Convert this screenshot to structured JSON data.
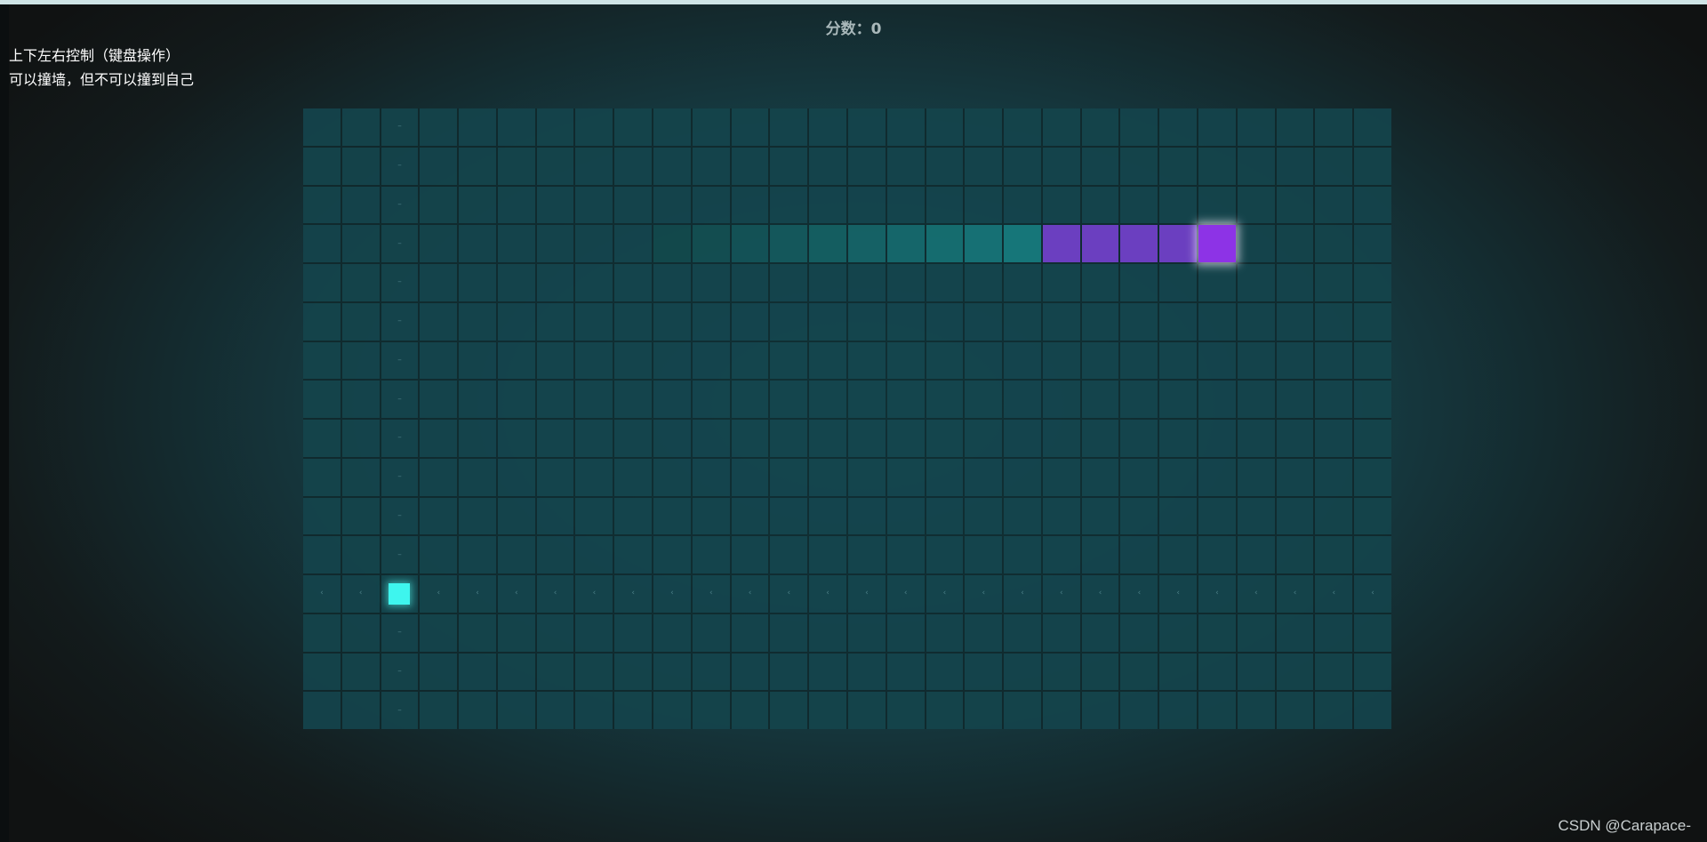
{
  "header": {
    "score_label": "分数：",
    "score_value": "0"
  },
  "instructions": {
    "line1": "上下左右控制（键盘操作）",
    "line2": "可以撞墙，但不可以撞到自己"
  },
  "board": {
    "cols": 28,
    "rows": 16,
    "snake": [
      [
        23,
        3
      ],
      [
        22,
        3
      ],
      [
        21,
        3
      ],
      [
        20,
        3
      ],
      [
        19,
        3
      ]
    ],
    "snake_direction": "right",
    "trail": [
      [
        9,
        3
      ],
      [
        10,
        3
      ],
      [
        11,
        3
      ],
      [
        12,
        3
      ],
      [
        13,
        3
      ],
      [
        14,
        3
      ],
      [
        15,
        3
      ],
      [
        16,
        3
      ],
      [
        17,
        3
      ],
      [
        18,
        3
      ]
    ],
    "food": [
      2,
      12
    ],
    "guide_column": 2,
    "guide_row": 12,
    "colors": {
      "snake_body": "#6b3fc0",
      "snake_head": "#8d33e6",
      "food": "#3ef5ee",
      "trail": "#177a7d"
    }
  },
  "watermark": "CSDN @Carapace-"
}
